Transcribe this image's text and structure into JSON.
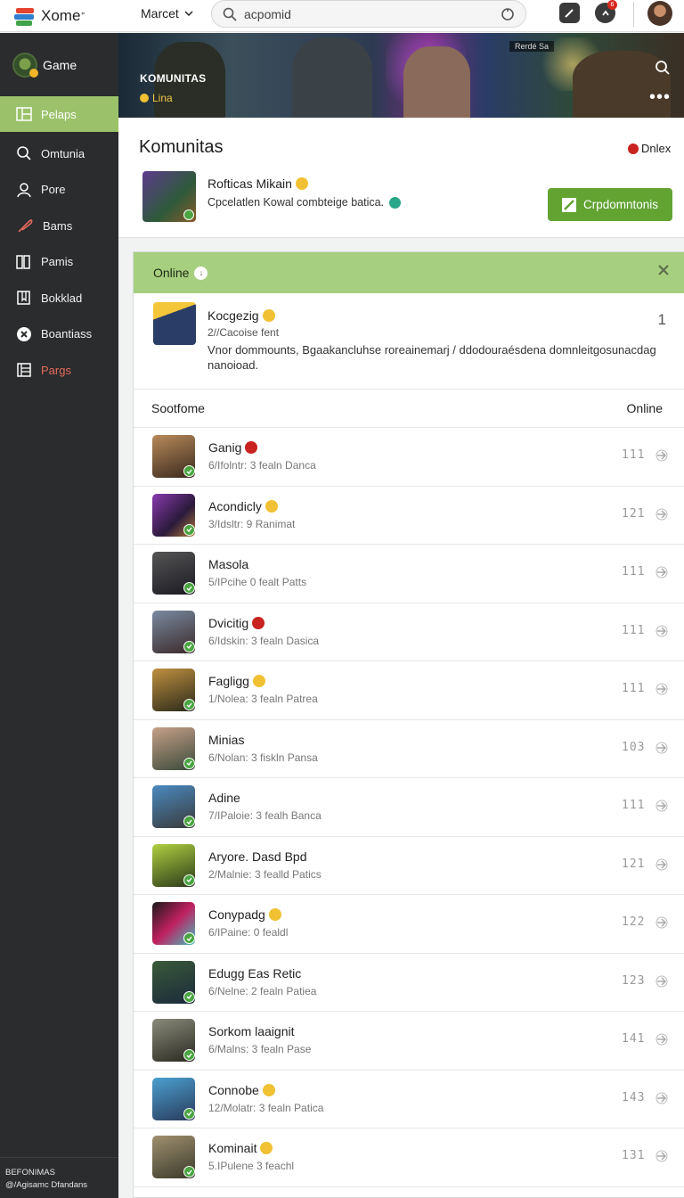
{
  "topbar": {
    "app_name": "Xome",
    "app_superscript": "\"",
    "market_label": "Marcet",
    "search_value": "acpomid",
    "notification_count": "6"
  },
  "sidebar": {
    "game_label": "Game",
    "items": [
      {
        "label": "Pelaps",
        "icon": "grid-icon",
        "active": true
      },
      {
        "label": "Omtunia",
        "icon": "search-icon"
      },
      {
        "label": "Pore",
        "icon": "user-icon"
      },
      {
        "label": "Bams",
        "icon": "feather-icon"
      },
      {
        "label": "Pamis",
        "icon": "book-icon"
      },
      {
        "label": "Bokklad",
        "icon": "bookmark-icon"
      },
      {
        "label": "Boantiass",
        "icon": "compass-icon"
      },
      {
        "label": "Pargs",
        "icon": "pages-icon",
        "highlight": "#e46a5c"
      }
    ],
    "footer_line1": "BEFONIMAS",
    "footer_line2": "@/Agisamc Dfandans"
  },
  "banner": {
    "title": "KOMUNITAS",
    "subtitle": "Lina",
    "tag": "Rerdé Sa"
  },
  "community": {
    "title": "Komunitas",
    "status_label": "Dnlex",
    "name": "Rofticas Mikain",
    "description": "Cpcelatlen Kowal combteige batica.",
    "action_button": "Crpdomntonis"
  },
  "panel": {
    "header": "Online",
    "featured": {
      "name": "Kocgezig",
      "sub": "2//Cacoise fent",
      "description": "Vnor dommounts, Bgaakancluhse roreainemarj / ddodouraésdena domnleitgosunacdag nanoioad.",
      "count": "1"
    },
    "list_header_left": "Sootfome",
    "list_header_right": "Online",
    "rows": [
      {
        "name": "Ganig",
        "sub": "6/Ifolntr: 3 fealn Danca",
        "count": "111",
        "badge": "r"
      },
      {
        "name": "Acondicly",
        "sub": "3/Idsltr: 9 Ranimat",
        "count": "121",
        "badge": "y"
      },
      {
        "name": "Masola",
        "sub": "5/IPcihe 0 fealt Patts",
        "count": "111",
        "badge": ""
      },
      {
        "name": "Dvicitig",
        "sub": "6/Idskin: 3 fealn Dasica",
        "count": "111",
        "badge": "r"
      },
      {
        "name": "Fagligg",
        "sub": "1/Nolea: 3 fealn Patrea",
        "count": "111",
        "badge": "y"
      },
      {
        "name": "Minias",
        "sub": "6/Nolan: 3 fiskln Pansa",
        "count": "103",
        "badge": ""
      },
      {
        "name": "Adine",
        "sub": "7/IPaloie: 3 fealh Banca",
        "count": "111",
        "badge": ""
      },
      {
        "name": "Aryore. Dasd Bpd",
        "sub": "2/Malnie: 3 fealld Patics",
        "count": "121",
        "badge": ""
      },
      {
        "name": "Conypadg",
        "sub": "6/IPaine: 0 fealdl",
        "count": "122",
        "badge": "y"
      },
      {
        "name": "Edugg Eas Retic",
        "sub": "6/Nelne: 2 fealn Patiea",
        "count": "123",
        "badge": ""
      },
      {
        "name": "Sorkom laaignit",
        "sub": "6/Malns: 3 fealn Pase",
        "count": "141",
        "badge": ""
      },
      {
        "name": "Connobe",
        "sub": "12/Molatr: 3 fealn Patica",
        "count": "143",
        "badge": "y"
      },
      {
        "name": "Kominait",
        "sub": "5.IPulene 3 feachl",
        "count": "131",
        "badge": "y"
      }
    ]
  },
  "colors": {
    "accent_green": "#62a332",
    "panel_head": "#a6cf7f",
    "sidebar_bg": "#2a2c2d"
  }
}
